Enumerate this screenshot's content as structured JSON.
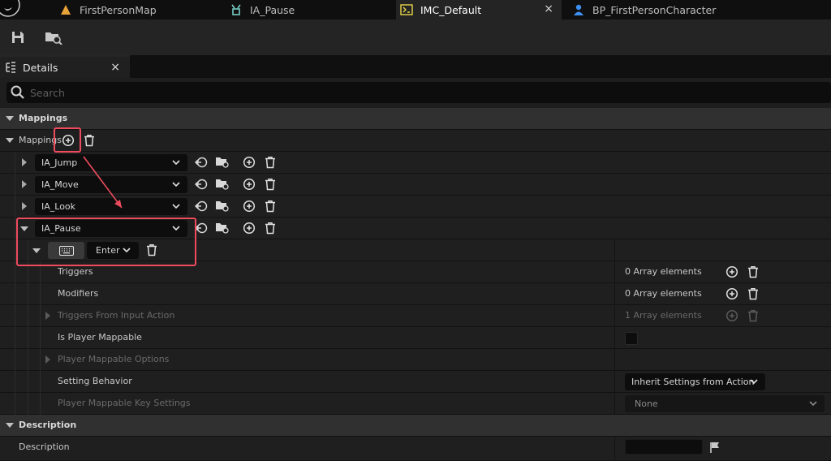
{
  "tabs": [
    {
      "label": "FirstPersonMap",
      "icon": "level-map-icon"
    },
    {
      "label": "IA_Pause",
      "icon": "input-action-icon"
    },
    {
      "label": "IMC_Default",
      "icon": "mapping-context-icon",
      "active": true,
      "close": "×"
    },
    {
      "label": "BP_FirstPersonCharacter",
      "icon": "blueprint-pawn-icon"
    }
  ],
  "toolbar": {
    "save_icon": "save-icon",
    "browse_icon": "browse-content-icon"
  },
  "panel": {
    "title": "Details",
    "close": "×"
  },
  "search": {
    "placeholder": "Search"
  },
  "category_mappings": "Mappings",
  "mappings": {
    "label": "Mappings",
    "entries": [
      {
        "action": "IA_Jump",
        "expanded": false
      },
      {
        "action": "IA_Move",
        "expanded": false
      },
      {
        "action": "IA_Look",
        "expanded": false
      },
      {
        "action": "IA_Pause",
        "expanded": true
      }
    ],
    "key_binding": {
      "key": "Enter",
      "icon": "keyboard-icon"
    }
  },
  "properties": {
    "triggers": {
      "label": "Triggers",
      "value": "0 Array elements"
    },
    "modifiers": {
      "label": "Modifiers",
      "value": "0 Array elements"
    },
    "triggers_from_action": {
      "label": "Triggers From Input Action",
      "value": "1 Array elements"
    },
    "is_player_mappable": {
      "label": "Is Player Mappable",
      "checked": false
    },
    "player_mappable_options": {
      "label": "Player Mappable Options"
    },
    "setting_behavior": {
      "label": "Setting Behavior",
      "value": "Inherit Settings from Action"
    },
    "player_mappable_key_settings": {
      "label": "Player Mappable Key Settings",
      "value": "None"
    }
  },
  "category_description": "Description",
  "description": {
    "label": "Description",
    "value": ""
  },
  "colors": {
    "highlight": "#ee4b5e",
    "background": "#1f1f1f",
    "category": "#303030"
  }
}
